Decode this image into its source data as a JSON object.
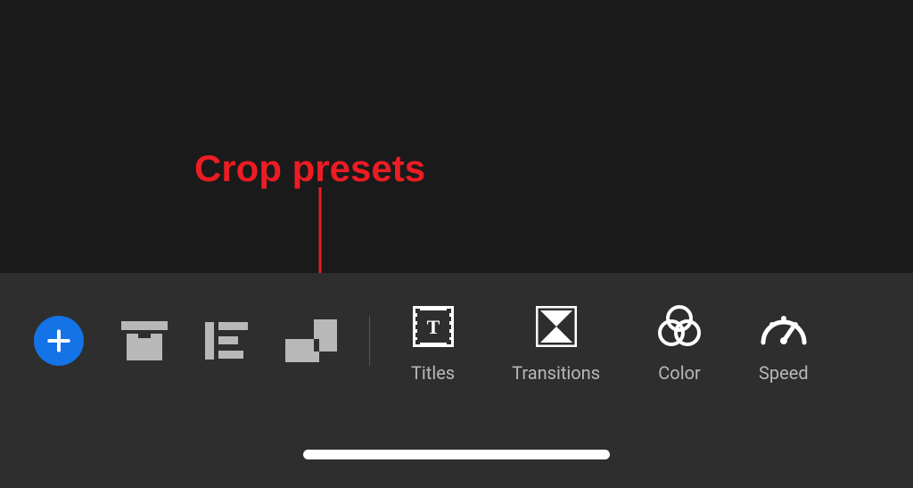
{
  "annotation": {
    "label": "Crop presets"
  },
  "toolbar": {
    "titles_label": "Titles",
    "transitions_label": "Transitions",
    "color_label": "Color",
    "speed_label": "Speed"
  }
}
